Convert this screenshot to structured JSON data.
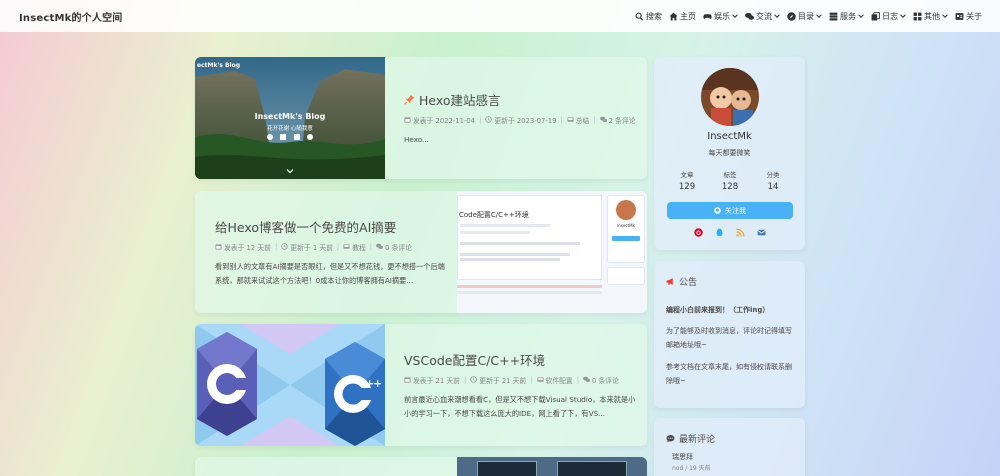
{
  "header": {
    "site_name": "InsectMk的个人空间",
    "menu": [
      {
        "label": "搜索",
        "icon": "search-icon",
        "caret": false
      },
      {
        "label": "主页",
        "icon": "home-icon",
        "caret": false
      },
      {
        "label": "娱乐",
        "icon": "game-icon",
        "caret": true
      },
      {
        "label": "交流",
        "icon": "comments-icon",
        "caret": true
      },
      {
        "label": "目录",
        "icon": "compass-icon",
        "caret": true
      },
      {
        "label": "服务",
        "icon": "server-icon",
        "caret": true
      },
      {
        "label": "日志",
        "icon": "copy-icon",
        "caret": true
      },
      {
        "label": "其他",
        "icon": "grid-icon",
        "caret": true
      },
      {
        "label": "关于",
        "icon": "id-card-icon",
        "caret": false
      }
    ]
  },
  "posts": [
    {
      "title": "Hexo建站感言",
      "pinned": true,
      "meta": {
        "published": "发表于 2022-11-04",
        "updated": "更新于 2023-07-19",
        "category": "总结",
        "comments": "2 条评论"
      },
      "excerpt": "Hexo...",
      "cover": {
        "blog_title": "InsectMk's Blog",
        "blog_subtitle": "花开花谢 心随我意",
        "corner_text": "ectMk's Blog"
      }
    },
    {
      "title": "给Hexo博客做一个免费的AI摘要",
      "pinned": false,
      "meta": {
        "published": "发表于 12 天前",
        "updated": "更新于 1 天前",
        "category": "教程",
        "comments": "0 条评论"
      },
      "excerpt": "看到别人的文章有AI摘要是否眼红，但是又不想花钱，更不想搭一个后端系统，那就来试试这个方法吧！0成本让你的博客拥有AI摘要...",
      "cover": {
        "heading": "Code配置C/C++环境",
        "profile_name": "InsectMk"
      }
    },
    {
      "title": "VSCode配置C/C++环境",
      "pinned": false,
      "meta": {
        "published": "发表于 21 天前",
        "updated": "更新于 21 天前",
        "category": "软件配置",
        "comments": "0 条评论"
      },
      "excerpt": "前言最近心血来潮想看看C，但是又不想下载Visual Studio，本来就是小小的学习一下，不想下载这么庞大的IDE，网上看了下，有VS..."
    }
  ],
  "author": {
    "name": "InsectMk",
    "description": "每天都要微笑",
    "stats": [
      {
        "label": "文章",
        "value": "129"
      },
      {
        "label": "标签",
        "value": "128"
      },
      {
        "label": "分类",
        "value": "14"
      }
    ],
    "follow_label": "关注我",
    "socials": [
      "netease-music-icon",
      "qq-icon",
      "rss-icon",
      "email-icon"
    ]
  },
  "announcement": {
    "title": "公告",
    "headline": "编程小白前来报到！（工作ing）",
    "line1": "为了能够及时收到消息，评论时记得填写邮箱地址哦~",
    "line2": "参考文档在文章末尾，如有侵权请联系删除哦~"
  },
  "comments_widget": {
    "title": "最新评论",
    "first_author": "瑞思拜",
    "first_meta": "nod / 19 天前"
  },
  "colors": {
    "accent": "#49b1f5",
    "pin": "#ff7242",
    "announcement_icon": "#f23a3a"
  }
}
